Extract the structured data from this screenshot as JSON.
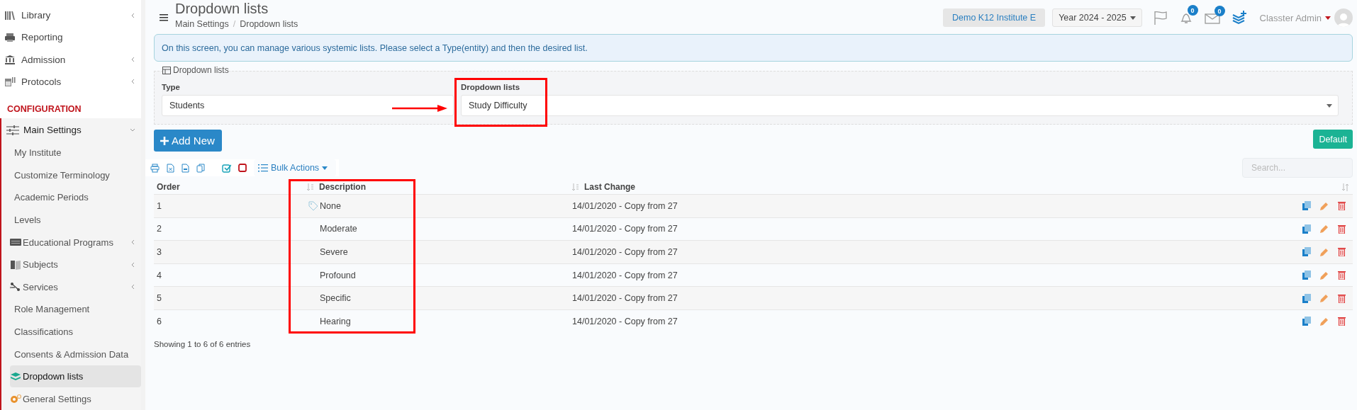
{
  "sidebar": {
    "top_items": [
      {
        "label": "Library",
        "expanded": false
      },
      {
        "label": "Reporting"
      },
      {
        "label": "Admission",
        "expanded": false
      },
      {
        "label": "Protocols",
        "expanded": false
      }
    ],
    "section_heading": "CONFIGURATION",
    "group": {
      "label": "Main Settings",
      "expanded": true,
      "children": [
        {
          "label": "My Institute",
          "selected": false
        },
        {
          "label": "Customize Terminology",
          "selected": false
        },
        {
          "label": "Academic Periods",
          "selected": false
        },
        {
          "label": "Levels",
          "selected": false
        },
        {
          "label": "Educational Programs",
          "selected": false,
          "expanded": false
        },
        {
          "label": "Subjects",
          "selected": false,
          "expanded": false
        },
        {
          "label": "Services",
          "selected": false,
          "expanded": false
        },
        {
          "label": "Role Management",
          "selected": false
        },
        {
          "label": "Classifications",
          "selected": false
        },
        {
          "label": "Consents & Admission Data",
          "selected": false
        },
        {
          "label": "Dropdown lists",
          "selected": true
        },
        {
          "label": "General Settings",
          "selected": false
        }
      ]
    }
  },
  "header": {
    "title": "Dropdown lists",
    "breadcrumb": [
      "Main Settings",
      "/",
      "Dropdown lists"
    ],
    "institute": "Demo K12 Institute E",
    "year": "Year 2024 - 2025",
    "notifications_count": "0",
    "messages_count": "0",
    "user": "Classter Admin"
  },
  "info": "On this screen, you can manage various systemic lists. Please select a Type(entity) and then the desired list.",
  "filter_panel": {
    "legend": "Dropdown lists",
    "fields": [
      {
        "label": "Type",
        "value": "Students"
      },
      {
        "label": "Dropdown lists",
        "value": "Study Difficulty"
      }
    ]
  },
  "buttons": {
    "add": "Add New",
    "default": "Default"
  },
  "toolbar": {
    "bulk_actions": "Bulk Actions"
  },
  "search": {
    "placeholder": "Search..."
  },
  "table": {
    "columns": [
      "Order",
      "Description",
      "Last Change"
    ],
    "rows": [
      {
        "order": "1",
        "description": "None",
        "last_change": "14/01/2020 - Copy from 27",
        "tagged": true
      },
      {
        "order": "2",
        "description": "Moderate",
        "last_change": "14/01/2020 - Copy from 27",
        "tagged": false
      },
      {
        "order": "3",
        "description": "Severe",
        "last_change": "14/01/2020 - Copy from 27",
        "tagged": false
      },
      {
        "order": "4",
        "description": "Profound",
        "last_change": "14/01/2020 - Copy from 27",
        "tagged": false
      },
      {
        "order": "5",
        "description": "Specific",
        "last_change": "14/01/2020 - Copy from 27",
        "tagged": false
      },
      {
        "order": "6",
        "description": "Hearing",
        "last_change": "14/01/2020 - Copy from 27",
        "tagged": false
      }
    ]
  },
  "footer": "Showing 1 to 6 of 6 entries"
}
